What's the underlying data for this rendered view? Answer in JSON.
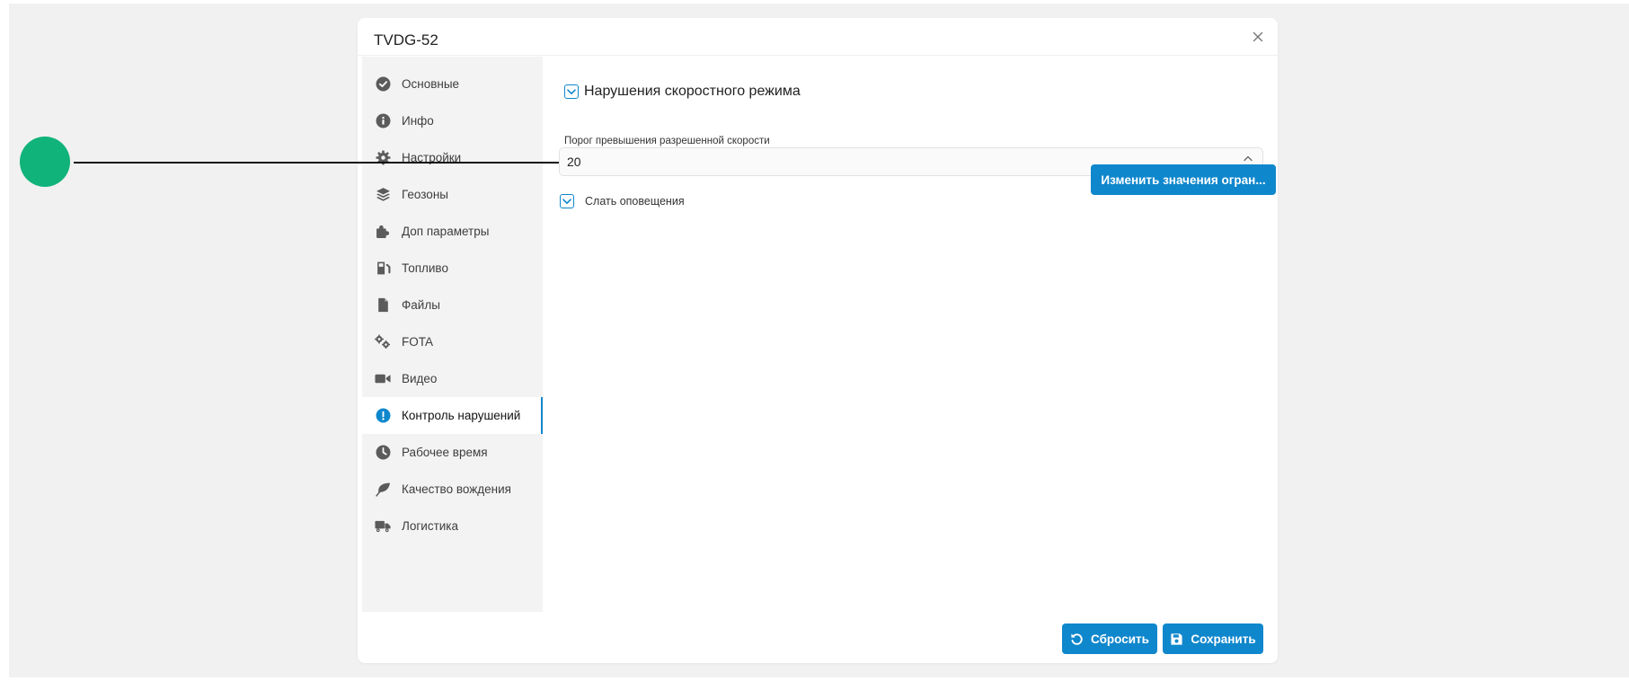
{
  "dialog": {
    "title": "TVDG-52"
  },
  "sidebar": {
    "items": [
      {
        "label": "Основные",
        "icon": "check-circle-icon"
      },
      {
        "label": "Инфо",
        "icon": "info-circle-icon"
      },
      {
        "label": "Настройки",
        "icon": "gear-icon"
      },
      {
        "label": "Геозоны",
        "icon": "layers-icon"
      },
      {
        "label": "Доп параметры",
        "icon": "puzzle-icon"
      },
      {
        "label": "Топливо",
        "icon": "fuel-pump-icon"
      },
      {
        "label": "Файлы",
        "icon": "file-icon"
      },
      {
        "label": "FOTA",
        "icon": "gears-icon"
      },
      {
        "label": "Видео",
        "icon": "video-camera-icon"
      },
      {
        "label": "Контроль нарушений",
        "icon": "exclamation-circle-icon"
      },
      {
        "label": "Рабочее время",
        "icon": "clock-icon"
      },
      {
        "label": "Качество вождения",
        "icon": "leaf-icon"
      },
      {
        "label": "Логистика",
        "icon": "truck-icon"
      }
    ],
    "active_index": 9
  },
  "speeding": {
    "title": "Нарушения скоростного режима",
    "enabled": true,
    "threshold_label": "Порог превышения разрешенной скорости",
    "threshold_value": "20",
    "notify_label": "Слать оповещения",
    "notify_enabled": true,
    "change_limits_label": "Изменить значения огран..."
  },
  "footer": {
    "reset_label": "Сбросить",
    "save_label": "Сохранить"
  },
  "colors": {
    "accent": "#0f87cc",
    "callout": "#10b37a",
    "sidebar_bg": "#f3f3f3"
  }
}
